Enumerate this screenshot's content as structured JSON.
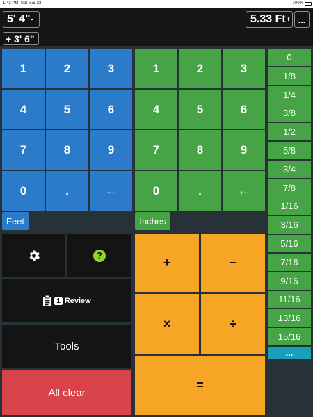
{
  "status": {
    "time": "1:43 PM",
    "date": "Sat Mar 23",
    "battery": "100%"
  },
  "display": {
    "primary": "5' 4\"",
    "primary_sup": "-",
    "converted": "5.33 Ft",
    "converted_sup": "+",
    "menu": "...",
    "history": "+ 3' 6\""
  },
  "feet_keys": [
    "1",
    "2",
    "3",
    "4",
    "5",
    "6",
    "7",
    "8",
    "9",
    "0",
    ".",
    "←"
  ],
  "inch_keys": [
    "1",
    "2",
    "3",
    "4",
    "5",
    "6",
    "7",
    "8",
    "9",
    "0",
    ".",
    "←"
  ],
  "labels": {
    "feet": "Feet",
    "inches": "Inches"
  },
  "tools": {
    "settings_icon": "gear-icon",
    "help_glyph": "?",
    "review_count": "1",
    "review_label": "Review",
    "tools_label": "Tools",
    "clear_label": "All clear"
  },
  "operators": {
    "add": "+",
    "subtract": "−",
    "multiply": "×",
    "divide": "÷",
    "equals": "="
  },
  "fractions": [
    "0",
    "1/8",
    "1/4",
    "3/8",
    "1/2",
    "5/8",
    "3/4",
    "7/8",
    "1/16",
    "3/16",
    "5/16",
    "7/16",
    "9/16",
    "11/16",
    "13/16",
    "15/16",
    "..."
  ],
  "colors": {
    "feet": "#2b7bc9",
    "inches": "#46a346",
    "operators": "#f6a525",
    "clear": "#d9434a",
    "more": "#19a0b9"
  }
}
